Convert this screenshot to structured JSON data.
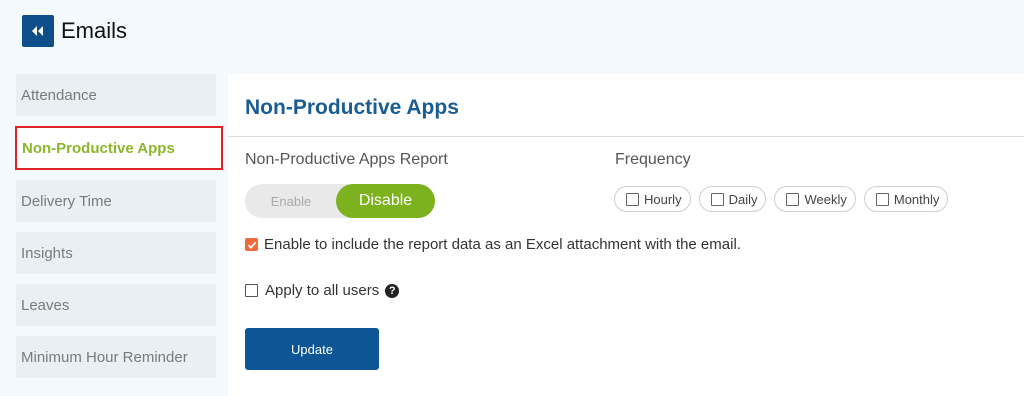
{
  "header": {
    "back_icon": "double-chevron-left-icon",
    "title": "Emails",
    "accent": "#0d4f8b"
  },
  "sidebar": {
    "items": [
      {
        "label": "Attendance",
        "active": false
      },
      {
        "label": "Non-Productive Apps",
        "active": true
      },
      {
        "label": "Delivery Time",
        "active": false
      },
      {
        "label": "Insights",
        "active": false
      },
      {
        "label": "Leaves",
        "active": false
      },
      {
        "label": "Minimum Hour Reminder",
        "active": false
      }
    ],
    "active_color": "#8ab82a",
    "highlight_border_color": "#e0222a"
  },
  "main": {
    "title": "Non-Productive Apps",
    "report_label": "Non-Productive Apps Report",
    "toggle": {
      "enable_label": "Enable",
      "disable_label": "Disable",
      "selected": "Disable",
      "active_color": "#7bb21e"
    },
    "frequency": {
      "label": "Frequency",
      "options": [
        {
          "label": "Hourly",
          "checked": false
        },
        {
          "label": "Daily",
          "checked": false
        },
        {
          "label": "Weekly",
          "checked": false
        },
        {
          "label": "Monthly",
          "checked": false
        }
      ]
    },
    "excel_option": {
      "label": "Enable to include the report data as an Excel attachment with the email.",
      "checked": true,
      "check_color": "#ef6b3a"
    },
    "apply_all": {
      "label": "Apply to all users",
      "checked": false,
      "help_icon": "question-circle-icon"
    },
    "update_button": {
      "label": "Update",
      "color": "#0d5594"
    }
  }
}
